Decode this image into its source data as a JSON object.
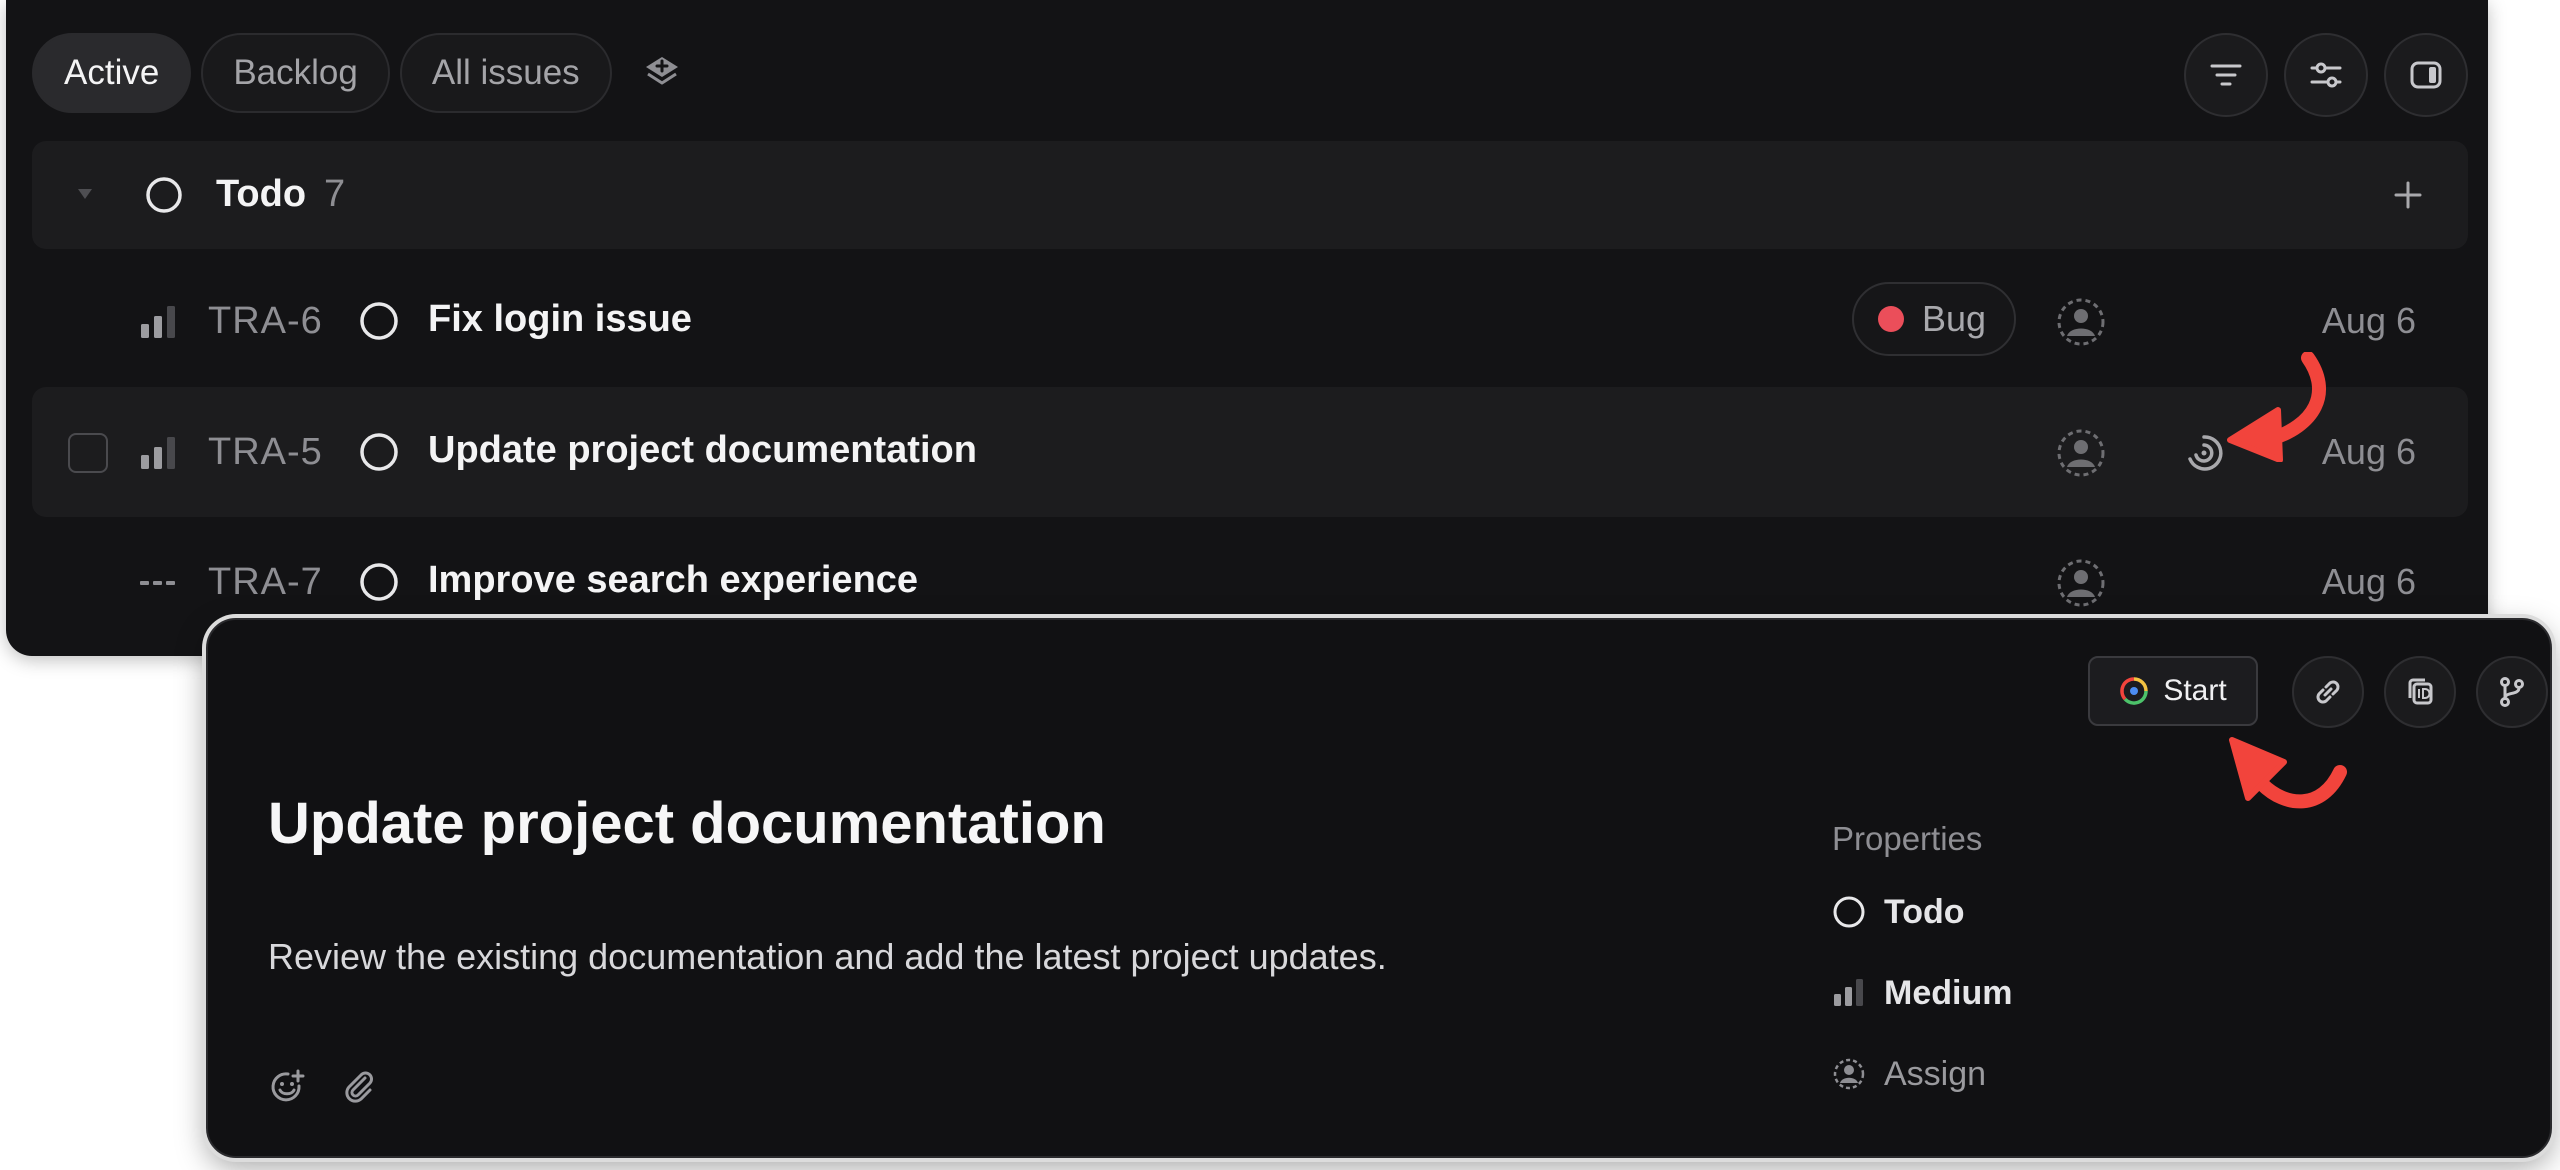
{
  "list": {
    "tabs": [
      {
        "label": "Active",
        "active": true
      },
      {
        "label": "Backlog",
        "active": false
      },
      {
        "label": "All issues",
        "active": false
      }
    ],
    "toolbar_icons": [
      "filter-icon",
      "display-options-icon",
      "side-panel-icon"
    ],
    "group": {
      "title": "Todo",
      "count": "7"
    },
    "issues": [
      {
        "id": "TRA-6",
        "title": "Fix login issue",
        "label": "Bug",
        "date": "Aug 6",
        "priority": "medium"
      },
      {
        "id": "TRA-5",
        "title": "Update project documentation",
        "label": "",
        "date": "Aug 6",
        "priority": "medium",
        "hovered": true
      },
      {
        "id": "TRA-7",
        "title": "Improve search experience",
        "label": "",
        "date": "Aug 6",
        "priority": "none"
      }
    ]
  },
  "detail": {
    "start_label": "Start",
    "title": "Update project documentation",
    "description": "Review the existing documentation and add the latest project updates.",
    "properties_heading": "Properties",
    "status": "Todo",
    "priority": "Medium",
    "assignee": "Assign"
  },
  "colors": {
    "bug_label": "#eb4e5a",
    "annotation_arrow": "#f2443c",
    "panel_bg": "#131315"
  }
}
